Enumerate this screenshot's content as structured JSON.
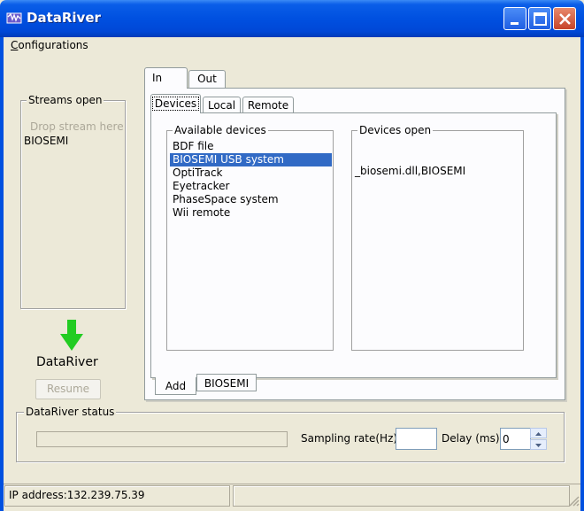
{
  "window": {
    "title": "DataRiver"
  },
  "menu": {
    "configurations": "Configurations"
  },
  "streams": {
    "group_label": "Streams open",
    "drop_hint": "Drop stream here",
    "items": [
      "BIOSEMI"
    ]
  },
  "dataflow": {
    "label": "DataRiver",
    "resume_label": "Resume"
  },
  "tabs": {
    "outer": [
      "In",
      "Out"
    ],
    "inner": [
      "Devices",
      "Local",
      "Remote"
    ],
    "bottom": [
      "Add",
      "BIOSEMI"
    ]
  },
  "devices": {
    "available_label": "Available devices",
    "available": [
      "BDF file",
      "BIOSEMI USB system",
      "OptiTrack",
      "Eyetracker",
      "PhaseSpace system",
      "Wii remote"
    ],
    "selected": "BIOSEMI USB system",
    "open_label": "Devices open",
    "open": [
      "_biosemi.dll,BIOSEMI"
    ]
  },
  "status": {
    "group_label": "DataRiver status",
    "sampling_rate_label": "Sampling rate(Hz)",
    "sampling_rate_value": "",
    "delay_label": "Delay (ms)",
    "delay_value": "0"
  },
  "statusbar": {
    "ip": "IP address:132.239.75.39"
  },
  "colors": {
    "titlebar": "#0050e0",
    "selection": "#316ac5",
    "arrow": "#22cc22",
    "face": "#ece9d8"
  }
}
